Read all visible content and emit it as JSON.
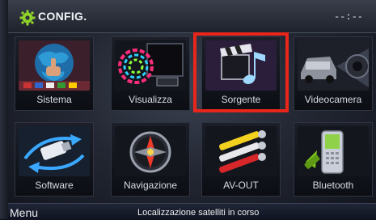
{
  "header": {
    "title": "CONFIG.",
    "clock": "--:--"
  },
  "tiles": [
    {
      "label": "Sistema"
    },
    {
      "label": "Visualizza"
    },
    {
      "label": "Sorgente"
    },
    {
      "label": "Videocamera"
    },
    {
      "label": "Software"
    },
    {
      "label": "Navigazione"
    },
    {
      "label": "AV-OUT"
    },
    {
      "label": "Bluetooth"
    }
  ],
  "selected_tile": "Sorgente",
  "footer": {
    "menu_label": "Menu",
    "status": "Localizzazione satelliti in corso"
  },
  "colors": {
    "highlight": "#e8261c",
    "accent_green": "#7ec41f"
  }
}
